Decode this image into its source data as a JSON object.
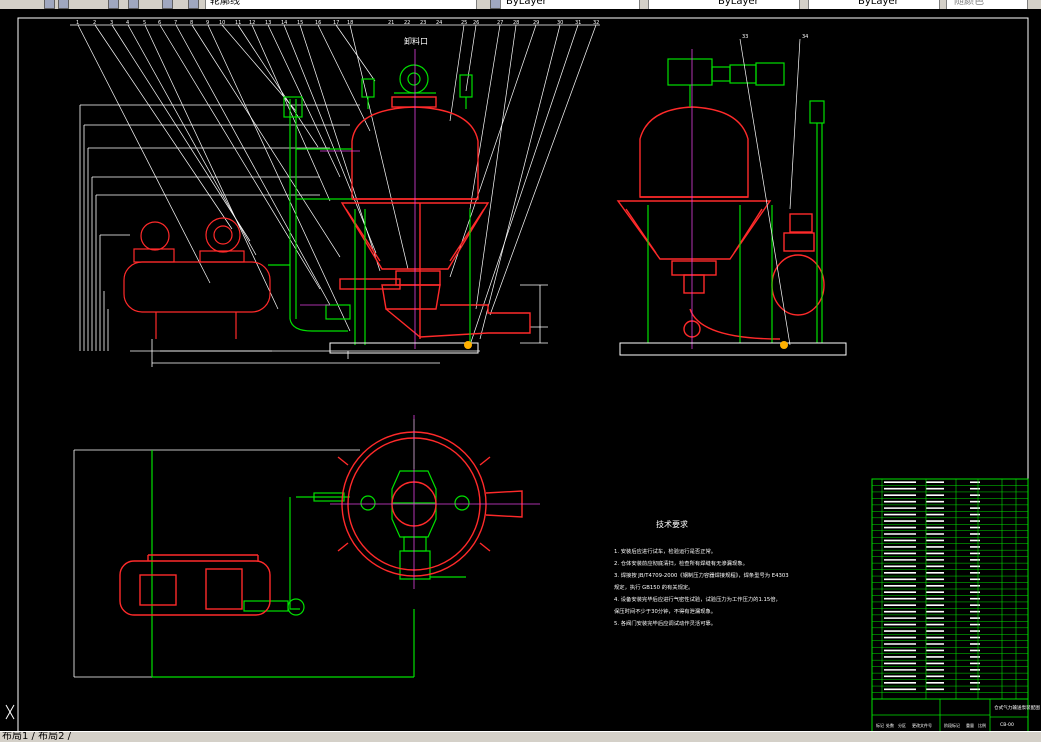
{
  "toolbar": {
    "linetype_label": "轮廓线",
    "color_value": "ByLayer",
    "linetype_value": "ByLayer",
    "lineweight_value": "ByLayer",
    "plotstyle_value": "随颜色"
  },
  "drawing": {
    "discharge_label": "卸料口",
    "tech_title": "技术要求",
    "tech_notes": [
      "1. 安装后应进行试车，检验运行是否正常。",
      "2. 仓体安装前应彻底清扫，检查所有焊缝有无渗漏现象。",
      "3. 焊接按 JB/T4709-2000《钢制压力容器焊接规程》，焊条型号为 E4303",
      "   规定，执行 GB150 的有关规定。",
      "4. 设备安装完毕后应进行气密性试验，试验压力为工作压力的1.15倍，",
      "   保压时间不少于30分钟，不得有泄漏现象。",
      "5. 各阀门安装完毕后应调试动作灵活可靠。"
    ],
    "title_block_name": "仓式气力输送泵装配图",
    "title_block_code": "CB-00"
  },
  "statusbar": {
    "layout1": "布局1",
    "layout2": "布局2"
  },
  "colors": {
    "red": "#ff2a2a",
    "green": "#00e000",
    "white": "#ffffff",
    "magenta": "#e040e0",
    "cyan": "#20d0d0"
  }
}
